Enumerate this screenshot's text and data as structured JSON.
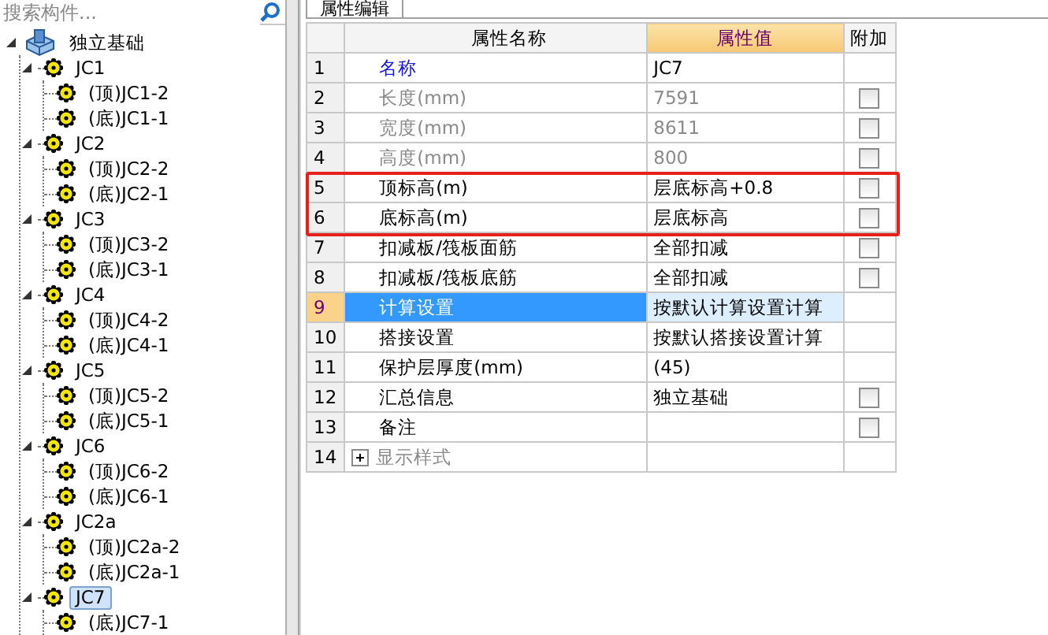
{
  "search": {
    "placeholder": "搜索构件..."
  },
  "tree": [
    {
      "label": "独立基础",
      "expanded": true,
      "selected": false,
      "children": [
        {
          "label": "JC1",
          "expanded": true,
          "selected": false,
          "children": [
            {
              "label": "(顶)JC1-2",
              "selected": false
            },
            {
              "label": "(底)JC1-1",
              "selected": false
            }
          ]
        },
        {
          "label": "JC2",
          "expanded": true,
          "selected": false,
          "children": [
            {
              "label": "(顶)JC2-2",
              "selected": false
            },
            {
              "label": "(底)JC2-1",
              "selected": false
            }
          ]
        },
        {
          "label": "JC3",
          "expanded": true,
          "selected": false,
          "children": [
            {
              "label": "(顶)JC3-2",
              "selected": false
            },
            {
              "label": "(底)JC3-1",
              "selected": false
            }
          ]
        },
        {
          "label": "JC4",
          "expanded": true,
          "selected": false,
          "children": [
            {
              "label": "(顶)JC4-2",
              "selected": false
            },
            {
              "label": "(底)JC4-1",
              "selected": false
            }
          ]
        },
        {
          "label": "JC5",
          "expanded": true,
          "selected": false,
          "children": [
            {
              "label": "(顶)JC5-2",
              "selected": false
            },
            {
              "label": "(底)JC5-1",
              "selected": false
            }
          ]
        },
        {
          "label": "JC6",
          "expanded": true,
          "selected": false,
          "children": [
            {
              "label": "(顶)JC6-2",
              "selected": false
            },
            {
              "label": "(底)JC6-1",
              "selected": false
            }
          ]
        },
        {
          "label": "JC2a",
          "expanded": true,
          "selected": false,
          "children": [
            {
              "label": "(顶)JC2a-2",
              "selected": false
            },
            {
              "label": "(底)JC2a-1",
              "selected": false
            }
          ]
        },
        {
          "label": "JC7",
          "expanded": true,
          "selected": true,
          "children": [
            {
              "label": "(底)JC7-1",
              "selected": false
            }
          ]
        }
      ]
    }
  ],
  "panel": {
    "tab": "属性编辑",
    "columns": [
      "属性名称",
      "属性值",
      "附加"
    ],
    "rows": [
      {
        "number": "1",
        "name": "名称",
        "value": "JC7",
        "kind": "link",
        "disabled": false,
        "selected": false,
        "highlighted": false
      },
      {
        "number": "2",
        "name": "长度(mm)",
        "value": "7591",
        "kind": "text",
        "disabled": true,
        "selected": false,
        "highlighted": false,
        "checkbox": {
          "checked": false
        }
      },
      {
        "number": "3",
        "name": "宽度(mm)",
        "value": "8611",
        "kind": "text",
        "disabled": true,
        "selected": false,
        "highlighted": false,
        "checkbox": {
          "checked": false
        }
      },
      {
        "number": "4",
        "name": "高度(mm)",
        "value": "800",
        "kind": "text",
        "disabled": true,
        "selected": false,
        "highlighted": false,
        "checkbox": {
          "checked": false
        }
      },
      {
        "number": "5",
        "name": "顶标高(m)",
        "value": "层底标高+0.8",
        "kind": "text",
        "disabled": false,
        "selected": false,
        "highlighted": true,
        "checkbox": {
          "checked": false
        }
      },
      {
        "number": "6",
        "name": "底标高(m)",
        "value": "层底标高",
        "kind": "text",
        "disabled": false,
        "selected": false,
        "highlighted": true,
        "checkbox": {
          "checked": false
        }
      },
      {
        "number": "7",
        "name": "扣减板/筏板面筋",
        "value": "全部扣减",
        "kind": "text",
        "disabled": false,
        "selected": false,
        "highlighted": false,
        "checkbox": {
          "checked": false
        }
      },
      {
        "number": "8",
        "name": "扣减板/筏板底筋",
        "value": "全部扣减",
        "kind": "text",
        "disabled": false,
        "selected": false,
        "highlighted": false,
        "checkbox": {
          "checked": false
        }
      },
      {
        "number": "9",
        "name": "计算设置",
        "value": "按默认计算设置计算",
        "kind": "text",
        "disabled": false,
        "selected": true,
        "highlighted": false
      },
      {
        "number": "10",
        "name": "搭接设置",
        "value": "按默认搭接设置计算",
        "kind": "text",
        "disabled": false,
        "selected": false,
        "highlighted": false
      },
      {
        "number": "11",
        "name": "保护层厚度(mm)",
        "value": "(45)",
        "kind": "text",
        "disabled": false,
        "selected": false,
        "highlighted": false
      },
      {
        "number": "12",
        "name": "汇总信息",
        "value": "独立基础",
        "kind": "text",
        "disabled": false,
        "selected": false,
        "highlighted": false,
        "checkbox": {
          "checked": false
        }
      },
      {
        "number": "13",
        "name": "备注",
        "kind": "text",
        "disabled": false,
        "selected": false,
        "highlighted": false,
        "checkbox": {
          "checked": false
        }
      },
      {
        "number": "14",
        "name": "显示样式",
        "kind": "group",
        "expanded": false,
        "disabled": true,
        "selected": false,
        "highlighted": false
      }
    ]
  }
}
